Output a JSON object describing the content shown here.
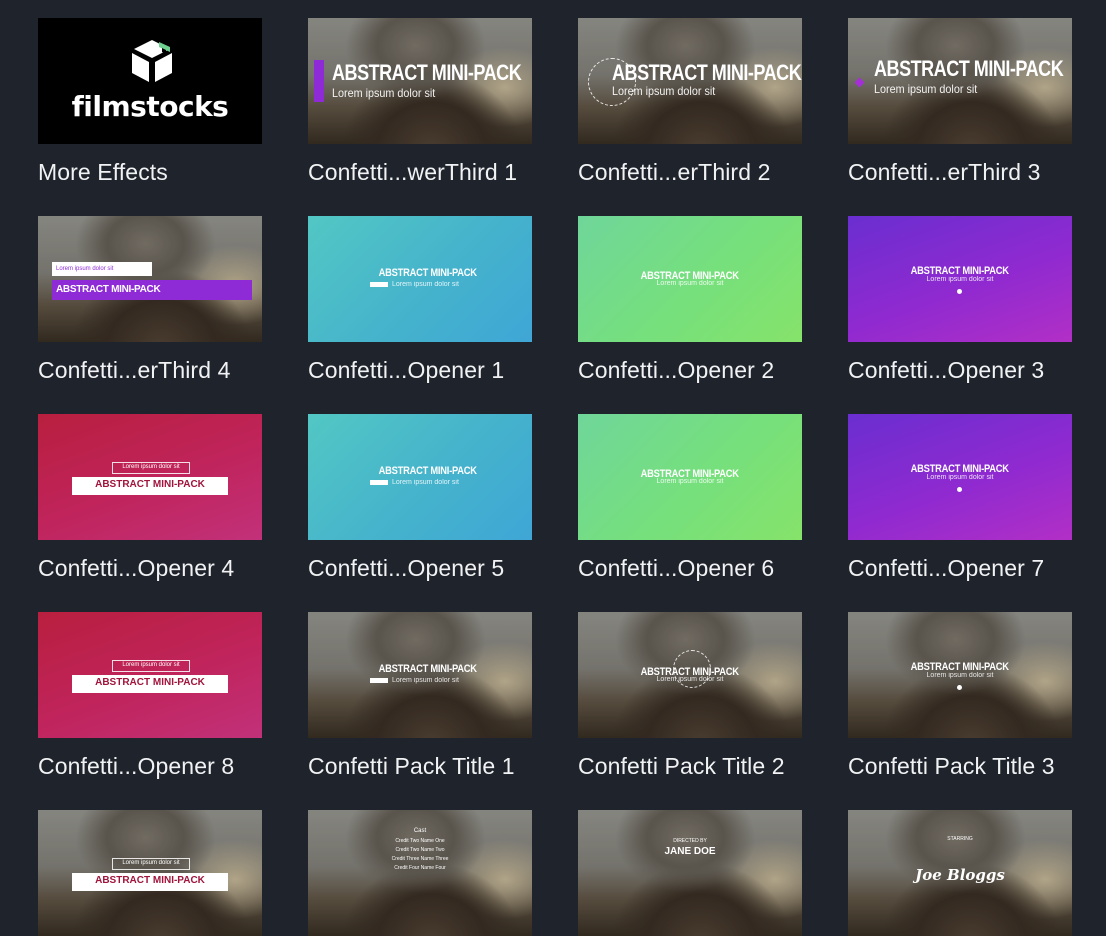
{
  "tiles": [
    {
      "label": "More Effects",
      "thumb": "filmstocks"
    },
    {
      "label": "Confetti...werThird 1",
      "thumb": "lowerthird",
      "overlay_title": "ABSTRACT MINI-PACK",
      "overlay_sub": "Lorem ipsum dolor sit"
    },
    {
      "label": "Confetti...erThird 2",
      "thumb": "lowerthird",
      "overlay_title": "ABSTRACT MINI-PACK",
      "overlay_sub": "Lorem ipsum dolor sit"
    },
    {
      "label": "Confetti...erThird 3",
      "thumb": "lowerthird",
      "overlay_title": "ABSTRACT MINI-PACK",
      "overlay_sub": "Lorem ipsum dolor sit"
    },
    {
      "label": "Confetti...erThird 4",
      "thumb": "lowerthird",
      "overlay_title": "ABSTRACT MINI-PACK",
      "overlay_sub": "Lorem ipsum dolor sit"
    },
    {
      "label": "Confetti...Opener 1",
      "thumb": "opener",
      "overlay_title": "ABSTRACT MINI-PACK",
      "overlay_sub": "Lorem ipsum dolor sit"
    },
    {
      "label": "Confetti...Opener 2",
      "thumb": "opener",
      "overlay_title": "ABSTRACT MINI-PACK",
      "overlay_sub": "Lorem ipsum dolor sit"
    },
    {
      "label": "Confetti...Opener 3",
      "thumb": "opener",
      "overlay_title": "ABSTRACT MINI-PACK",
      "overlay_sub": "Lorem ipsum dolor sit"
    },
    {
      "label": "Confetti...Opener 4",
      "thumb": "opener",
      "overlay_title": "ABSTRACT MINI-PACK",
      "overlay_sub": "Lorem ipsum dolor sit"
    },
    {
      "label": "Confetti...Opener 5",
      "thumb": "opener",
      "overlay_title": "ABSTRACT MINI-PACK",
      "overlay_sub": "Lorem ipsum dolor sit"
    },
    {
      "label": "Confetti...Opener 6",
      "thumb": "opener",
      "overlay_title": "ABSTRACT MINI-PACK",
      "overlay_sub": "Lorem ipsum dolor sit"
    },
    {
      "label": "Confetti...Opener 7",
      "thumb": "opener",
      "overlay_title": "ABSTRACT MINI-PACK",
      "overlay_sub": "Lorem ipsum dolor sit"
    },
    {
      "label": "Confetti...Opener 8",
      "thumb": "opener",
      "overlay_title": "ABSTRACT MINI-PACK",
      "overlay_sub": "Lorem ipsum dolor sit"
    },
    {
      "label": "Confetti Pack Title 1",
      "thumb": "title",
      "overlay_title": "ABSTRACT MINI-PACK",
      "overlay_sub": "Lorem ipsum dolor sit"
    },
    {
      "label": "Confetti Pack Title 2",
      "thumb": "title",
      "overlay_title": "ABSTRACT MINI-PACK",
      "overlay_sub": "Lorem ipsum dolor sit"
    },
    {
      "label": "Confetti Pack Title 3",
      "thumb": "title",
      "overlay_title": "ABSTRACT MINI-PACK",
      "overlay_sub": "Lorem ipsum dolor sit"
    },
    {
      "label": "",
      "thumb": "title",
      "overlay_title": "ABSTRACT MINI-PACK",
      "overlay_sub": "Lorem ipsum dolor sit"
    },
    {
      "label": "",
      "thumb": "credits",
      "overlay_title": "Cast",
      "overlay_lines": [
        "Credit Two  Name One",
        "Credit Two  Name Two",
        "Credit Three  Name Three",
        "Credit Four  Name Four"
      ]
    },
    {
      "label": "",
      "thumb": "title",
      "overlay_title": "JANE DOE",
      "overlay_sub": "DIRECTED BY"
    },
    {
      "label": "",
      "thumb": "title",
      "overlay_title": "Joe Bloggs",
      "overlay_sub": "STARRING"
    }
  ],
  "filmstocks_logo": {
    "wordmark": "filmstocks",
    "accent": "#6fd18f"
  },
  "colors": {
    "background": "#1f232b",
    "label_text": "#f1f2f4",
    "teal": "#45b3cc",
    "green": "#76e07c",
    "purple": "#8f2ad0",
    "magenta": "#c0245c",
    "accent_bar": "#8e2bd6"
  }
}
